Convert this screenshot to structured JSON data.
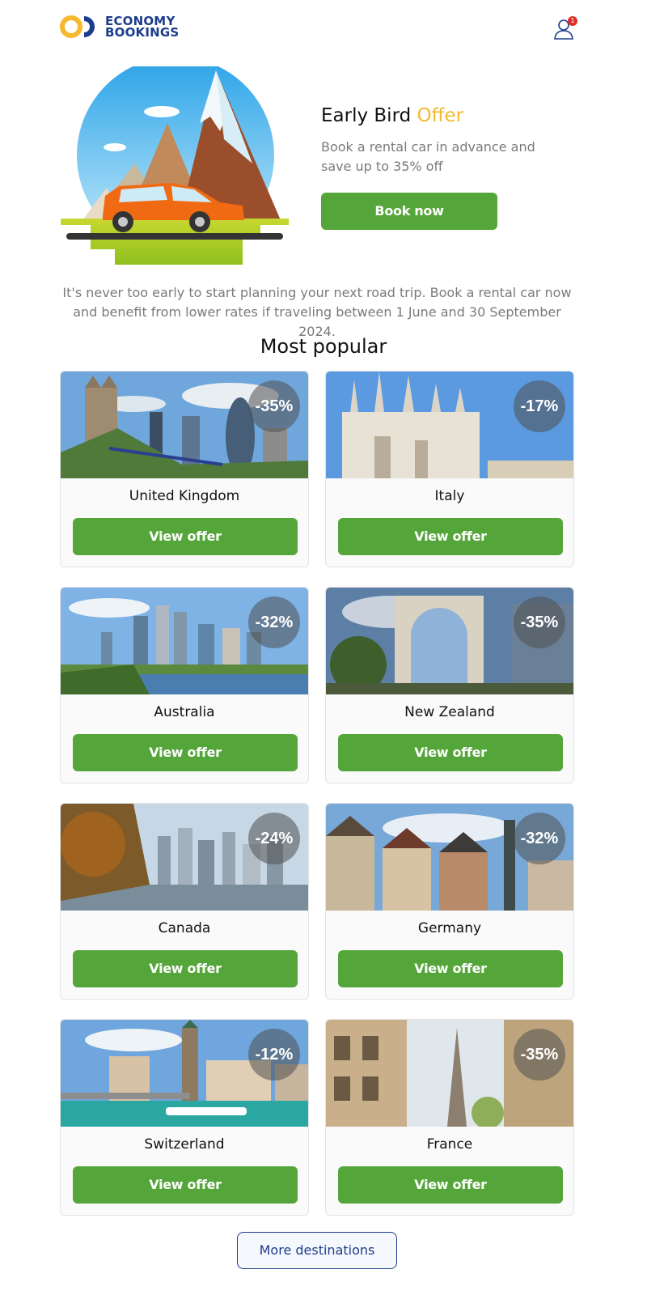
{
  "header": {
    "logo_line1": "ECONOMY",
    "logo_line2": "BOOKINGS",
    "notification_count": "1",
    "profile_icon": "user-icon"
  },
  "hero": {
    "title_main": "Early Bird",
    "title_accent": "Offer",
    "subtitle": "Book a rental car in advance and save up to 35% off",
    "button_label": "Book now"
  },
  "intro": "It's never too early to start planning your next road trip. Book a rental car now and benefit from lower rates if traveling between 1 June and 30 September 2024.",
  "section_title": "Most popular",
  "cards": [
    {
      "name": "United Kingdom",
      "discount": "-35%",
      "button": "View offer"
    },
    {
      "name": "Italy",
      "discount": "-17%",
      "button": "View offer"
    },
    {
      "name": "Australia",
      "discount": "-32%",
      "button": "View offer"
    },
    {
      "name": "New Zealand",
      "discount": "-35%",
      "button": "View offer"
    },
    {
      "name": "Canada",
      "discount": "-24%",
      "button": "View offer"
    },
    {
      "name": "Germany",
      "discount": "-32%",
      "button": "View offer"
    },
    {
      "name": "Switzerland",
      "discount": "-12%",
      "button": "View offer"
    },
    {
      "name": "France",
      "discount": "-35%",
      "button": "View offer"
    }
  ],
  "more_button": "More destinations",
  "colors": {
    "brand_blue": "#1c3c8c",
    "brand_yellow": "#f5b82e",
    "button_green": "#55a63a"
  }
}
